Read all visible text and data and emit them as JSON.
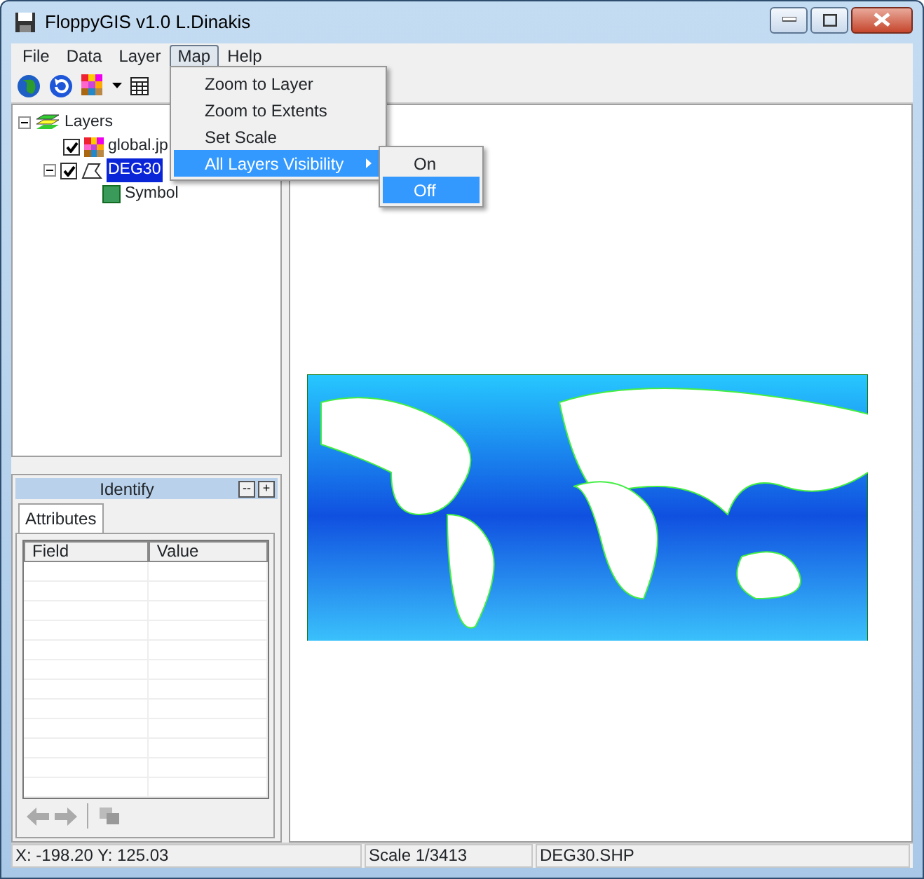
{
  "window": {
    "title": "FloppyGIS v1.0 L.Dinakis"
  },
  "menu_bar": [
    {
      "label": "File",
      "selected": false
    },
    {
      "label": "Data",
      "selected": false
    },
    {
      "label": "Layer",
      "selected": false
    },
    {
      "label": "Map",
      "selected": true
    },
    {
      "label": "Help",
      "selected": false
    }
  ],
  "open_menu": {
    "items": [
      {
        "label": "Zoom to Layer",
        "selected": false,
        "submenu": false
      },
      {
        "label": "Zoom to Extents",
        "selected": false,
        "submenu": false
      },
      {
        "label": "Set Scale",
        "selected": false,
        "submenu": false
      },
      {
        "label": "All Layers Visibility",
        "selected": true,
        "submenu": true
      }
    ]
  },
  "submenu": {
    "items": [
      {
        "label": "On",
        "selected": false
      },
      {
        "label": "Off",
        "selected": true
      }
    ]
  },
  "layer_tree": {
    "label": "Layers",
    "expanded": true,
    "children": [
      {
        "label": "global.jp",
        "kind": "raster",
        "checked": true,
        "selected": false
      },
      {
        "label": "DEG30",
        "kind": "vector",
        "checked": true,
        "selected": true,
        "expanded": true,
        "children": [
          {
            "label": "Symbol",
            "kind": "symbol"
          }
        ]
      }
    ]
  },
  "identify_panel": {
    "title": "Identify",
    "buttons": [
      "--",
      "+"
    ],
    "tabs": [
      {
        "label": "Attributes",
        "selected": true
      }
    ],
    "columns": [
      "Field",
      "Value"
    ]
  },
  "status_bar": [
    "X: -198.20 Y: 125.03",
    "Scale 1/3413",
    "DEG30.SHP"
  ]
}
